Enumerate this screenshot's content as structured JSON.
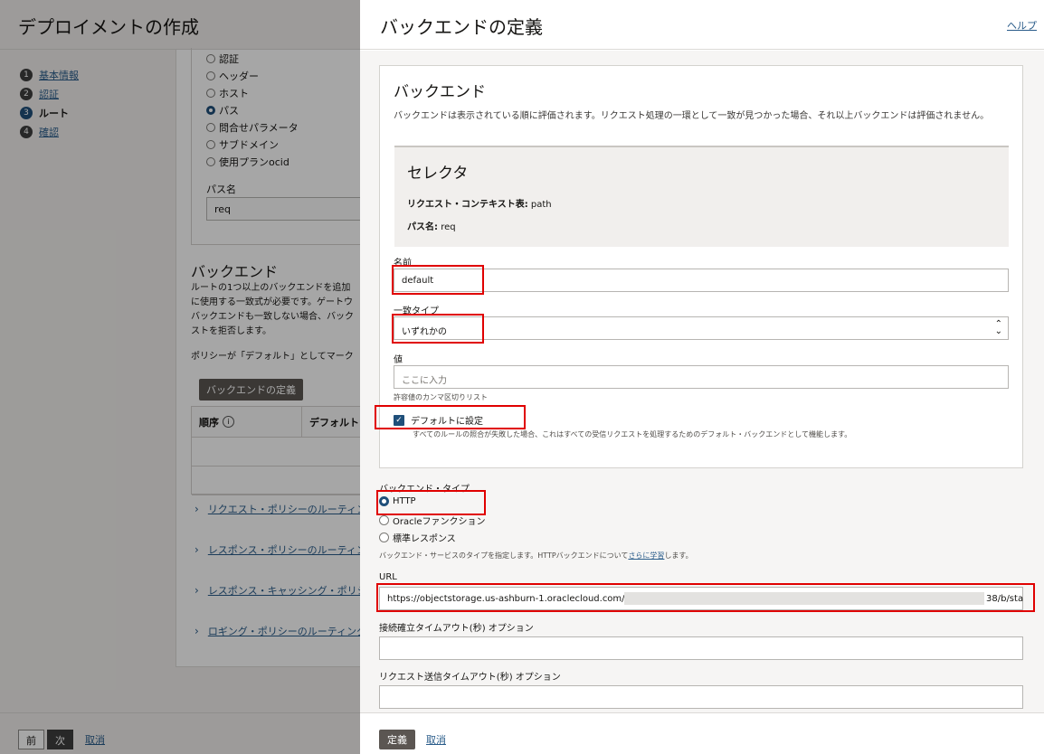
{
  "background": {
    "title": "デプロイメントの作成",
    "steps": [
      {
        "num": "1",
        "label": "基本情報"
      },
      {
        "num": "2",
        "label": "認証"
      },
      {
        "num": "3",
        "label": "ルート"
      },
      {
        "num": "4",
        "label": "確認"
      }
    ],
    "selector_options": [
      "認証",
      "ヘッダー",
      "ホスト",
      "パス",
      "問合せパラメータ",
      "サブドメイン",
      "使用プランocid"
    ],
    "selected_option": "パス",
    "path_label": "パス名",
    "path_value": "req",
    "backends_title": "バックエンド",
    "backends_desc": "ルートの1つ以上のバックエンドを追加\nに使用する一致式が必要です。ゲートウ\nバックエンドも一致しない場合、バック\nストを拒否します。",
    "policy_note": "ポリシーが「デフォルト」としてマーク",
    "define_backend_button": "バックエンドの定義",
    "table_headers": [
      "順序",
      "デフォルト"
    ],
    "accordions": [
      "リクエスト・ポリシーのルーティン",
      "レスポンス・ポリシーのルーティン",
      "レスポンス・キャッシング・ポリシ",
      "ロギング・ポリシーのルーティング"
    ],
    "footer": {
      "prev": "前",
      "next": "次",
      "cancel": "取消"
    }
  },
  "drawer": {
    "title": "バックエンドの定義",
    "help": "ヘルプ",
    "backend": {
      "title": "バックエンド",
      "description": "バックエンドは表示されている順に評価されます。リクエスト処理の一環として一致が見つかった場合、それ以上バックエンドは評価されません。"
    },
    "selector": {
      "title": "セレクタ",
      "context_label": "リクエスト・コンテキスト表:",
      "context_value": "path",
      "path_label": "パス名:",
      "path_value": "req"
    },
    "name": {
      "label": "名前",
      "value": "default"
    },
    "match_type": {
      "label": "一致タイプ",
      "value": "いずれかの"
    },
    "value": {
      "label": "値",
      "placeholder": "ここに入力",
      "hint": "許容値のカンマ区切りリスト"
    },
    "default_checkbox": {
      "label": "デフォルトに設定",
      "checked": true,
      "hint": "すべてのルールの照合が失敗した場合、これはすべての受信リクエストを処理するためのデフォルト・バックエンドとして機能します。"
    },
    "backend_type": {
      "label": "バックエンド・タイプ",
      "options": [
        "HTTP",
        "Oracleファンクション",
        "標準レスポンス"
      ],
      "selected": "HTTP",
      "hint_before": "バックエンド・サービスのタイプを指定します。HTTPバックエンドについて",
      "hint_link": "さらに学習",
      "hint_after": "します。"
    },
    "url": {
      "label": "URL",
      "value_prefix": "https://objectstorage.us-ashburn-1.oraclecloud.com/p/b",
      "value_suffix": "38/b/sta"
    },
    "connect_timeout": {
      "label": "接続確立タイムアウト(秒)",
      "optional": "オプション"
    },
    "send_timeout": {
      "label": "リクエスト送信タイムアウト(秒)",
      "optional": "オプション"
    },
    "footer": {
      "define": "定義",
      "cancel": "取消"
    }
  },
  "colors": {
    "accent": "#1f4f7a",
    "highlight": "#e00000",
    "link": "#2a5c8a",
    "button_dark": "#5b5652"
  }
}
